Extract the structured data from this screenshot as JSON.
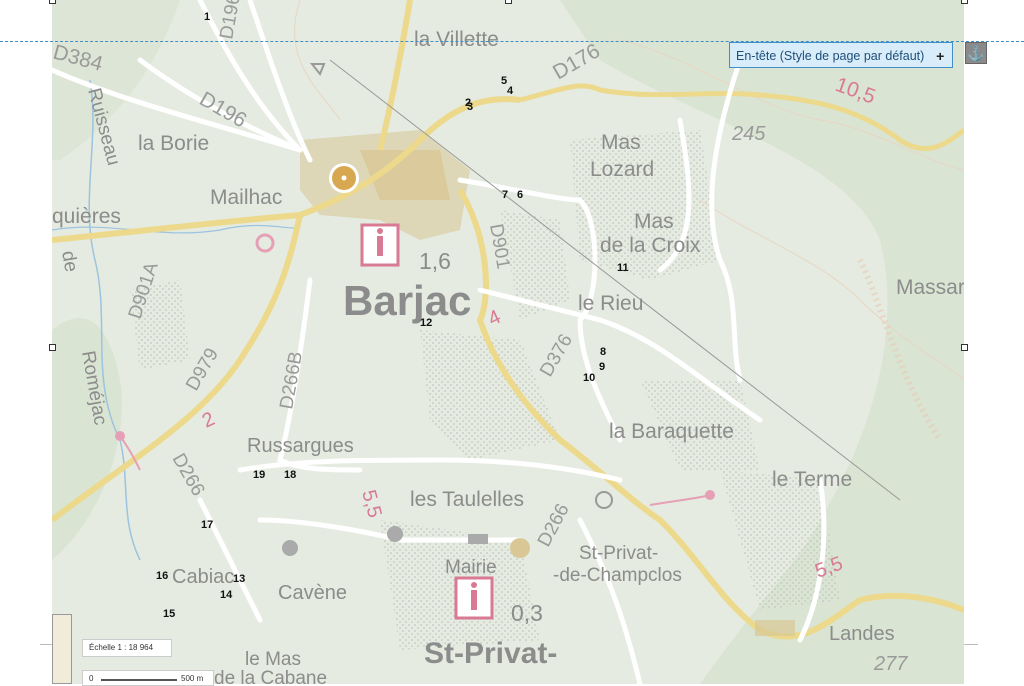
{
  "header": {
    "label": "En-tête (Style de page par défaut)",
    "plus": "+"
  },
  "icons": {
    "anchor": "anchor-icon"
  },
  "map": {
    "places": {
      "barjac": "Barjac",
      "villette": "la Villette",
      "borie": "la Borie",
      "mailhac": "Mailhac",
      "quieres": "quières",
      "mas_lozard_1": "Mas",
      "mas_lozard_2": "Lozard",
      "mas_croix_1": "Mas",
      "mas_croix_2": "de la Croix",
      "massar": "Massar",
      "le_rieu": "le Rieu",
      "baraquette": "la Baraquette",
      "le_terme": "le Terme",
      "russargues": "Russargues",
      "taulelles": "les Taulelles",
      "st_privat_1": "St-Privat-",
      "st_privat_2": "-de-Champclos",
      "mairie": "Mairie",
      "st_privat_big": "St-Privat-",
      "cabiac": "Cabiac",
      "cavene": "Cavène",
      "landes": "Landes",
      "le_mas_1": "le Mas",
      "le_mas_2": "de la Cabane",
      "romejac": "Roméjac",
      "ruisseau": "Ruisseau",
      "de": "de"
    },
    "roads": {
      "d384": "D384",
      "d196": "D196",
      "d196a": "D196A",
      "d176": "D176",
      "d901": "D901",
      "d901a": "D901A",
      "d979": "D979",
      "d266b": "D266B",
      "d376": "D376",
      "d266_w": "D266",
      "d266_e": "D266"
    },
    "distances": {
      "d_16": "1,6",
      "d_03": "0,3",
      "d_105": "10,5",
      "d_55a": "5,5",
      "d_55b": "5,5",
      "d_4": "4",
      "d_2": "2"
    },
    "elevations": {
      "e245": "245",
      "e277": "277"
    },
    "markers": [
      "1",
      "2",
      "3",
      "4",
      "5",
      "6",
      "7",
      "8",
      "9",
      "10",
      "11",
      "12",
      "13",
      "14",
      "15",
      "16",
      "17",
      "18",
      "19"
    ]
  },
  "scale": {
    "label": "Échelle 1 :",
    "value": "18 964",
    "bar_start": "0",
    "bar_end": "500 m"
  },
  "colors": {
    "header_border": "#3d8ec9",
    "header_bg": "#d9ecfa",
    "road_yellow": "#ecd98c",
    "map_bg": "#e5ebe0",
    "town": "#d9c795",
    "pink": "#d97a95"
  }
}
